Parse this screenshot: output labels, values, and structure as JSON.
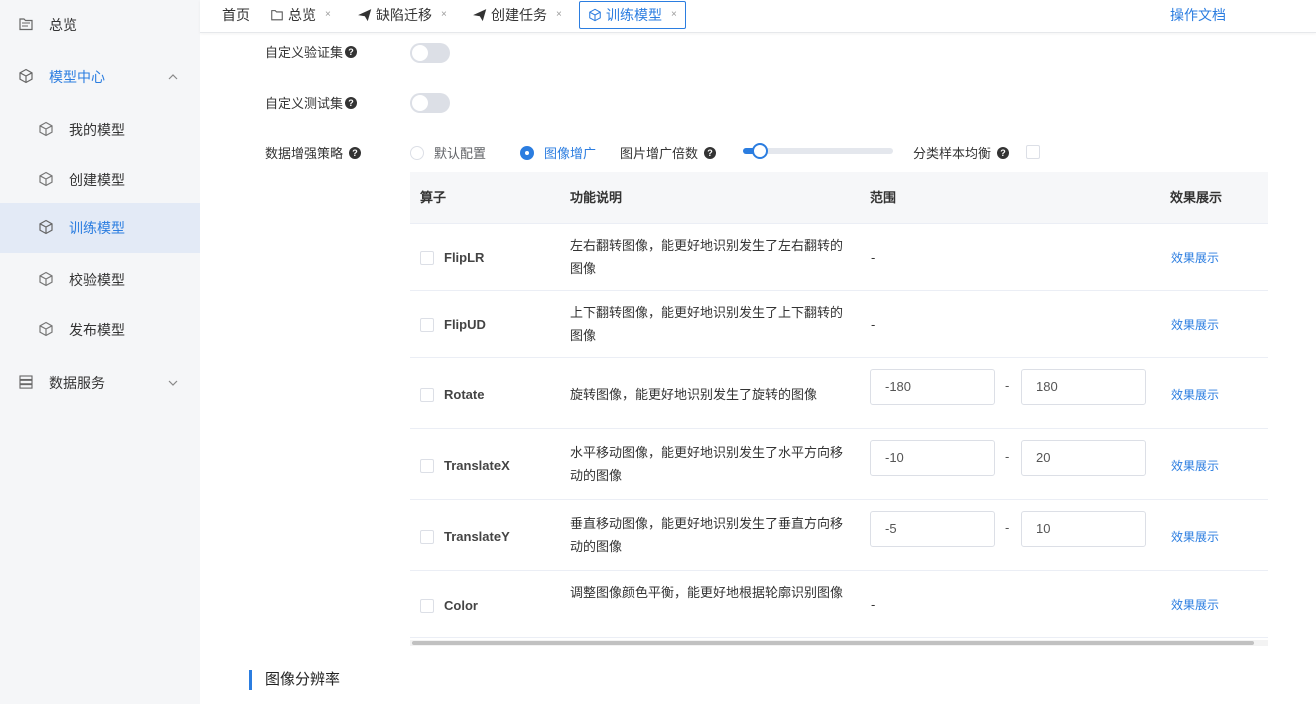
{
  "sidebar": {
    "items": [
      {
        "label": "总览",
        "icon": "folder-icon"
      },
      {
        "label": "模型中心",
        "icon": "cube-icon"
      },
      {
        "label": "我的模型",
        "icon": "cube-icon"
      },
      {
        "label": "创建模型",
        "icon": "cube-icon"
      },
      {
        "label": "训练模型",
        "icon": "cube-icon"
      },
      {
        "label": "校验模型",
        "icon": "cube-icon"
      },
      {
        "label": "发布模型",
        "icon": "cube-icon"
      },
      {
        "label": "数据服务",
        "icon": "server-icon"
      }
    ]
  },
  "tabs": [
    {
      "label": "首页"
    },
    {
      "label": "总览",
      "close": "×"
    },
    {
      "label": "缺陷迁移",
      "close": "×"
    },
    {
      "label": "创建任务",
      "close": "×"
    },
    {
      "label": "训练模型",
      "close": "×"
    }
  ],
  "header": {
    "doc_link": "操作文档"
  },
  "form": {
    "custom_val_label": "自定义验证集",
    "custom_test_label": "自定义测试集",
    "augment_label": "数据增强策略",
    "radio_default": "默认配置",
    "radio_augment": "图像增广",
    "factor_label": "图片增广倍数",
    "factor_value_fraction": 0.11,
    "balance_label": "分类样本均衡",
    "help_glyph": "?"
  },
  "table": {
    "headers": [
      "算子",
      "功能说明",
      "范围",
      "效果展示"
    ],
    "rows": [
      {
        "op": "FlipLR",
        "desc": "左右翻转图像，能更好地识别发生了左右翻转的图像",
        "range": "-",
        "effect": "效果展示"
      },
      {
        "op": "FlipUD",
        "desc": "上下翻转图像，能更好地识别发生了上下翻转的图像",
        "range": "-",
        "effect": "效果展示"
      },
      {
        "op": "Rotate",
        "desc": "旋转图像，能更好地识别发生了旋转的图像",
        "min": "-180",
        "sep": "-",
        "max": "180",
        "effect": "效果展示"
      },
      {
        "op": "TranslateX",
        "desc": "水平移动图像，能更好地识别发生了水平方向移动的图像",
        "min": "-10",
        "sep": "-",
        "max": "20",
        "effect": "效果展示"
      },
      {
        "op": "TranslateY",
        "desc": "垂直移动图像，能更好地识别发生了垂直方向移动的图像",
        "min": "-5",
        "sep": "-",
        "max": "10",
        "effect": "效果展示"
      },
      {
        "op": "Color",
        "desc": "调整图像颜色平衡，能更好地根据轮廓识别图像",
        "range": "-",
        "effect": "效果展示"
      }
    ]
  },
  "section": {
    "title": "图像分辨率"
  },
  "colors": {
    "accent": "#2b7de0",
    "sidebar_bg": "#f5f6f8",
    "active_bg": "#e3eaf6"
  }
}
